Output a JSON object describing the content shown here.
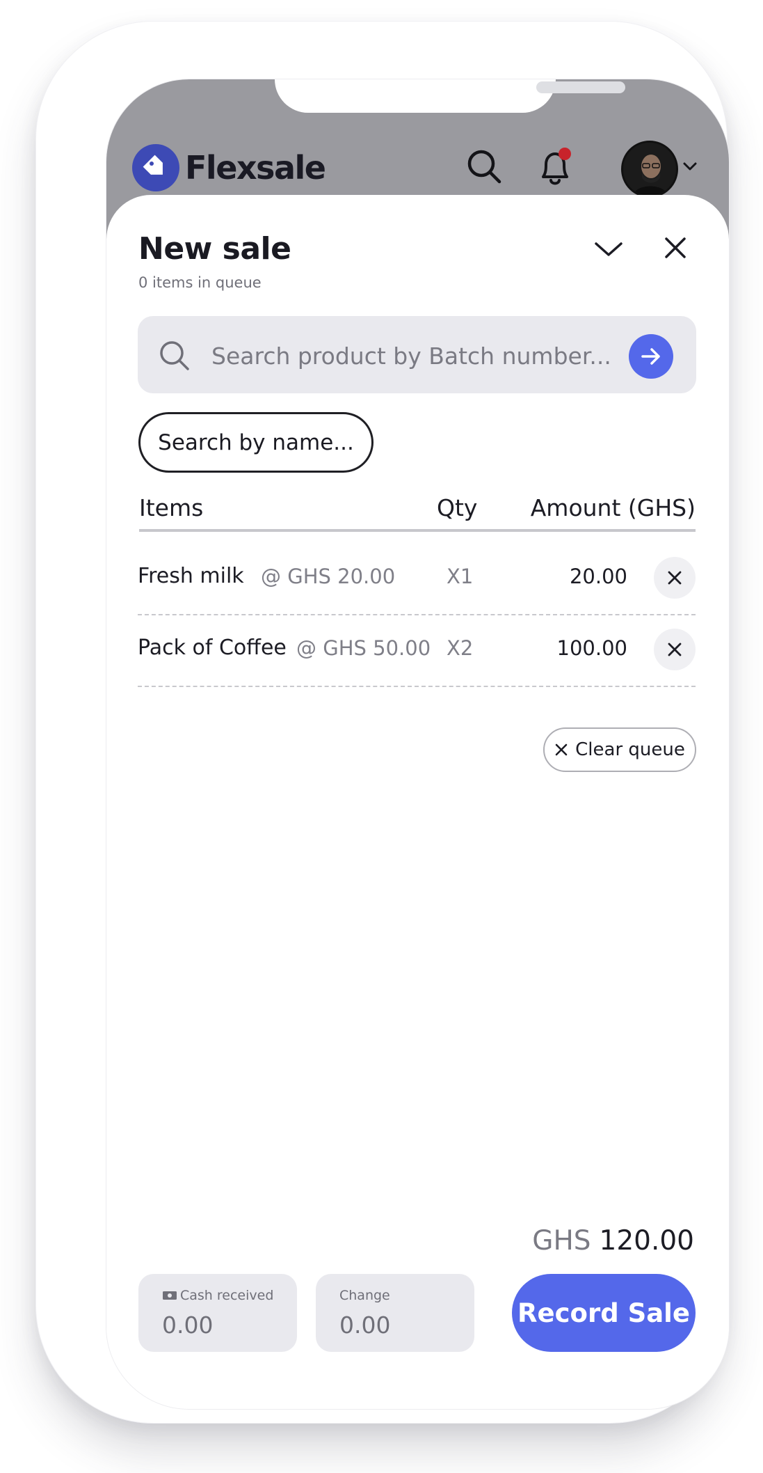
{
  "app": {
    "brand_name": "Flexsale",
    "brand_color": "#3d4ab5",
    "accent_color": "#5468ea",
    "notification_dot_color": "#c8232b",
    "header_icons": [
      "search-icon",
      "bell-icon",
      "avatar",
      "chevron-down-icon"
    ]
  },
  "sheet": {
    "title": "New sale",
    "subtitle": "0 items in queue",
    "batch_search_placeholder": "Search product by Batch number...",
    "name_search_label": "Search by name...",
    "columns": {
      "items": "Items",
      "qty": "Qty",
      "amount": "Amount (GHS)"
    },
    "rows": [
      {
        "name": "Fresh milk",
        "unit_price": "@ GHS 20.00",
        "qty": "X1",
        "amount": "20.00"
      },
      {
        "name": "Pack of Coffee",
        "unit_price": "@ GHS 50.00",
        "qty": "X2",
        "amount": "100.00"
      }
    ],
    "clear_queue_label": "Clear queue",
    "total_currency": "GHS",
    "total_value": "120.00",
    "cash_received_label": "Cash received",
    "cash_received_value": "0.00",
    "change_label": "Change",
    "change_value": "0.00",
    "record_button_label": "Record Sale"
  }
}
